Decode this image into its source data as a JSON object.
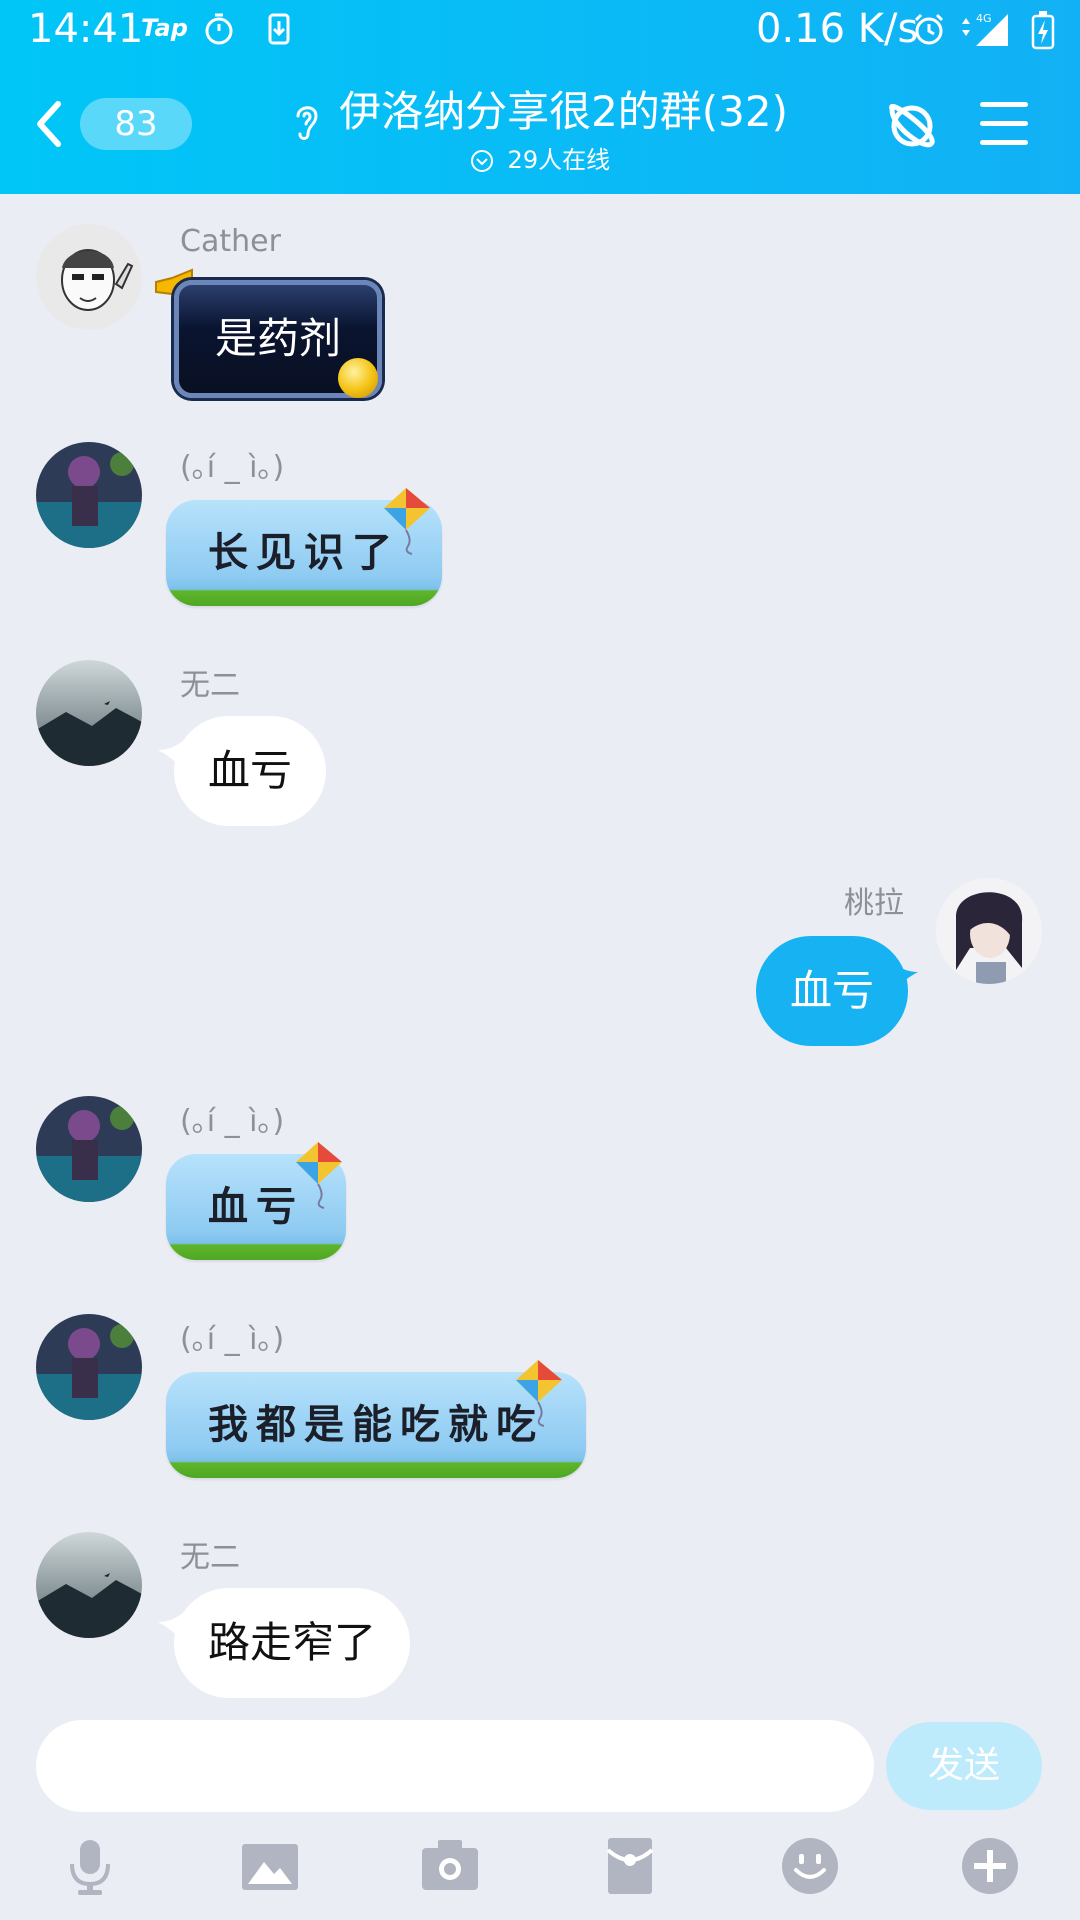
{
  "status_bar": {
    "time": "14:41",
    "app_badge": "Tap",
    "network_speed": "0.16 K/s",
    "network_type": "4G"
  },
  "nav": {
    "unread_count": "83",
    "group_title": "伊洛纳分享很2的群(32)",
    "online_text": "29人在线"
  },
  "messages": [
    {
      "sender": "Cather",
      "text": "是药剂",
      "side": "left",
      "style": "dark-frame"
    },
    {
      "sender": "(｡í _ ì｡)",
      "text": "长见识了",
      "side": "left",
      "style": "kite"
    },
    {
      "sender": "无二",
      "text": "血亏",
      "side": "left",
      "style": "plain"
    },
    {
      "sender": "桃拉",
      "text": "血亏",
      "side": "right",
      "style": "self"
    },
    {
      "sender": "(｡í _ ì｡)",
      "text": "血亏",
      "side": "left",
      "style": "kite"
    },
    {
      "sender": "(｡í _ ì｡)",
      "text": "我都是能吃就吃",
      "side": "left",
      "style": "kite"
    },
    {
      "sender": "无二",
      "text": "路走窄了",
      "side": "left",
      "style": "plain"
    }
  ],
  "composer": {
    "input_value": "",
    "send_label": "发送"
  },
  "toolbar_icons": [
    "microphone-icon",
    "image-icon",
    "camera-icon",
    "red-packet-icon",
    "emoji-icon",
    "plus-icon"
  ],
  "colors": {
    "header": "#12B1F5",
    "background": "#EBEDF5",
    "self_bubble": "#17B2F2",
    "send_disabled": "#BDEBFC",
    "toolbar_icon": "#B1B5C2"
  }
}
